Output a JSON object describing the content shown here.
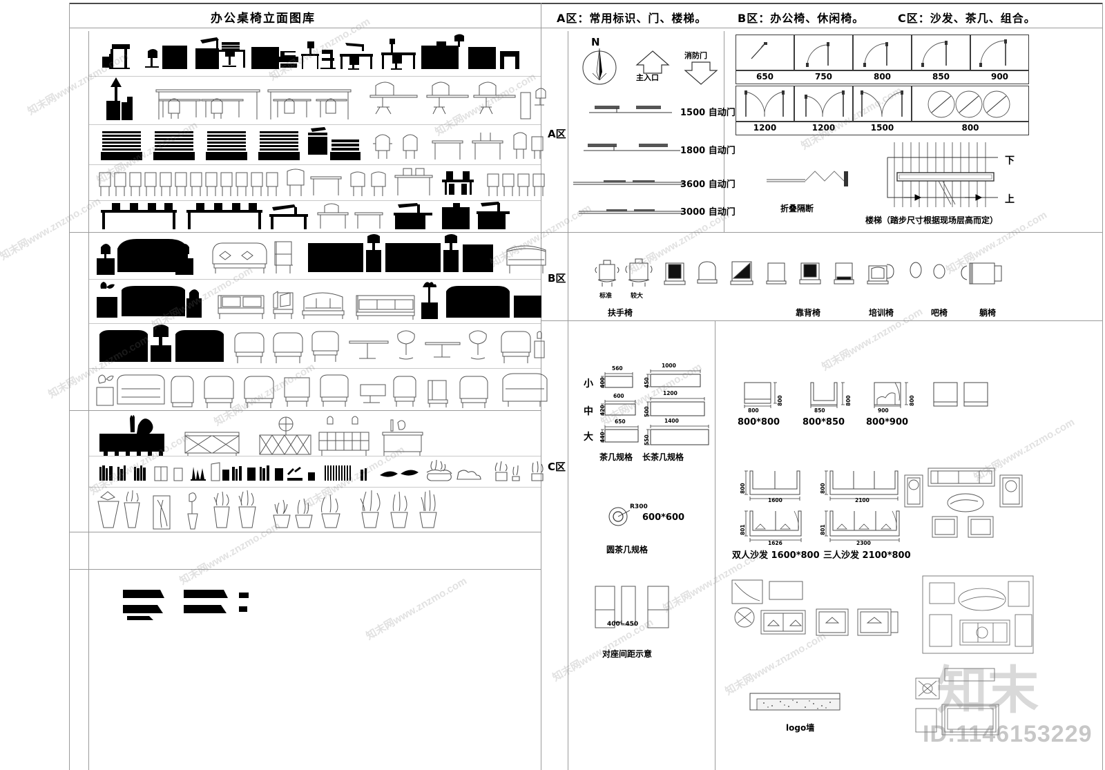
{
  "sheet": {
    "title": "办公桌椅立面图库",
    "zone_headers": [
      "A区：常用标识、门、楼梯。",
      "B区：办公椅、休闲椅。",
      "C区：沙发、茶几、组合。"
    ],
    "zone_tags": [
      "A区",
      "B区",
      "C区"
    ]
  },
  "zone_a": {
    "compass_label": "N",
    "main_entrance": "主入口",
    "fire_door": "消防门",
    "auto_doors": [
      {
        "size": "1500",
        "label": "自动门"
      },
      {
        "size": "1800",
        "label": "自动门"
      },
      {
        "size": "3600",
        "label": "自动门"
      },
      {
        "size": "3000",
        "label": "自动门"
      }
    ],
    "door_table_row1": [
      "650",
      "750",
      "800",
      "850",
      "900"
    ],
    "door_table_row2": [
      "1200",
      "1200",
      "1500",
      "800"
    ],
    "partition_label": "折叠隔断",
    "stair_label": "楼梯（踏步尺寸根据现场层高而定）",
    "stair_down": "下",
    "stair_up": "上"
  },
  "zone_b": {
    "size_labels": [
      "标准",
      "较大"
    ],
    "categories": [
      "扶手椅",
      "靠背椅",
      "培训椅",
      "吧椅",
      "躺椅"
    ]
  },
  "zone_c": {
    "coffee_table": {
      "caption": "茶几规格",
      "rows": [
        {
          "size": "小",
          "w": "560",
          "d": "400"
        },
        {
          "size": "中",
          "w": "600",
          "d": "420"
        },
        {
          "size": "大",
          "w": "650",
          "d": "440"
        }
      ]
    },
    "long_coffee_table": {
      "caption": "长茶几规格",
      "rows": [
        {
          "w": "1000",
          "d": "450"
        },
        {
          "w": "1200",
          "d": "500"
        },
        {
          "w": "1400",
          "d": "550"
        }
      ]
    },
    "round_table": {
      "caption": "圆茶几规格",
      "radius": "R300",
      "size": "600*600"
    },
    "seat_gap": {
      "caption": "对座间距示意",
      "dim": "400~450"
    },
    "single_seats": [
      {
        "label": "800*800",
        "w": "800",
        "h": "800"
      },
      {
        "label": "800*850",
        "w": "850",
        "h": "800"
      },
      {
        "label": "800*900",
        "w": "900",
        "h": "800"
      }
    ],
    "sofas": [
      {
        "caption": "双人沙发 1600*800",
        "plan_w": "1600",
        "plan_h": "800",
        "det_w": "1626",
        "det_h": "801"
      },
      {
        "caption": "三人沙发 2100*800",
        "plan_w": "2100",
        "plan_h": "800",
        "det_w": "2300",
        "det_h": "801"
      }
    ],
    "logo_wall": "logo墙"
  },
  "watermarks": {
    "site": "知末网www.znzmo.com",
    "brand": "知末",
    "id": "ID:1146153229"
  }
}
